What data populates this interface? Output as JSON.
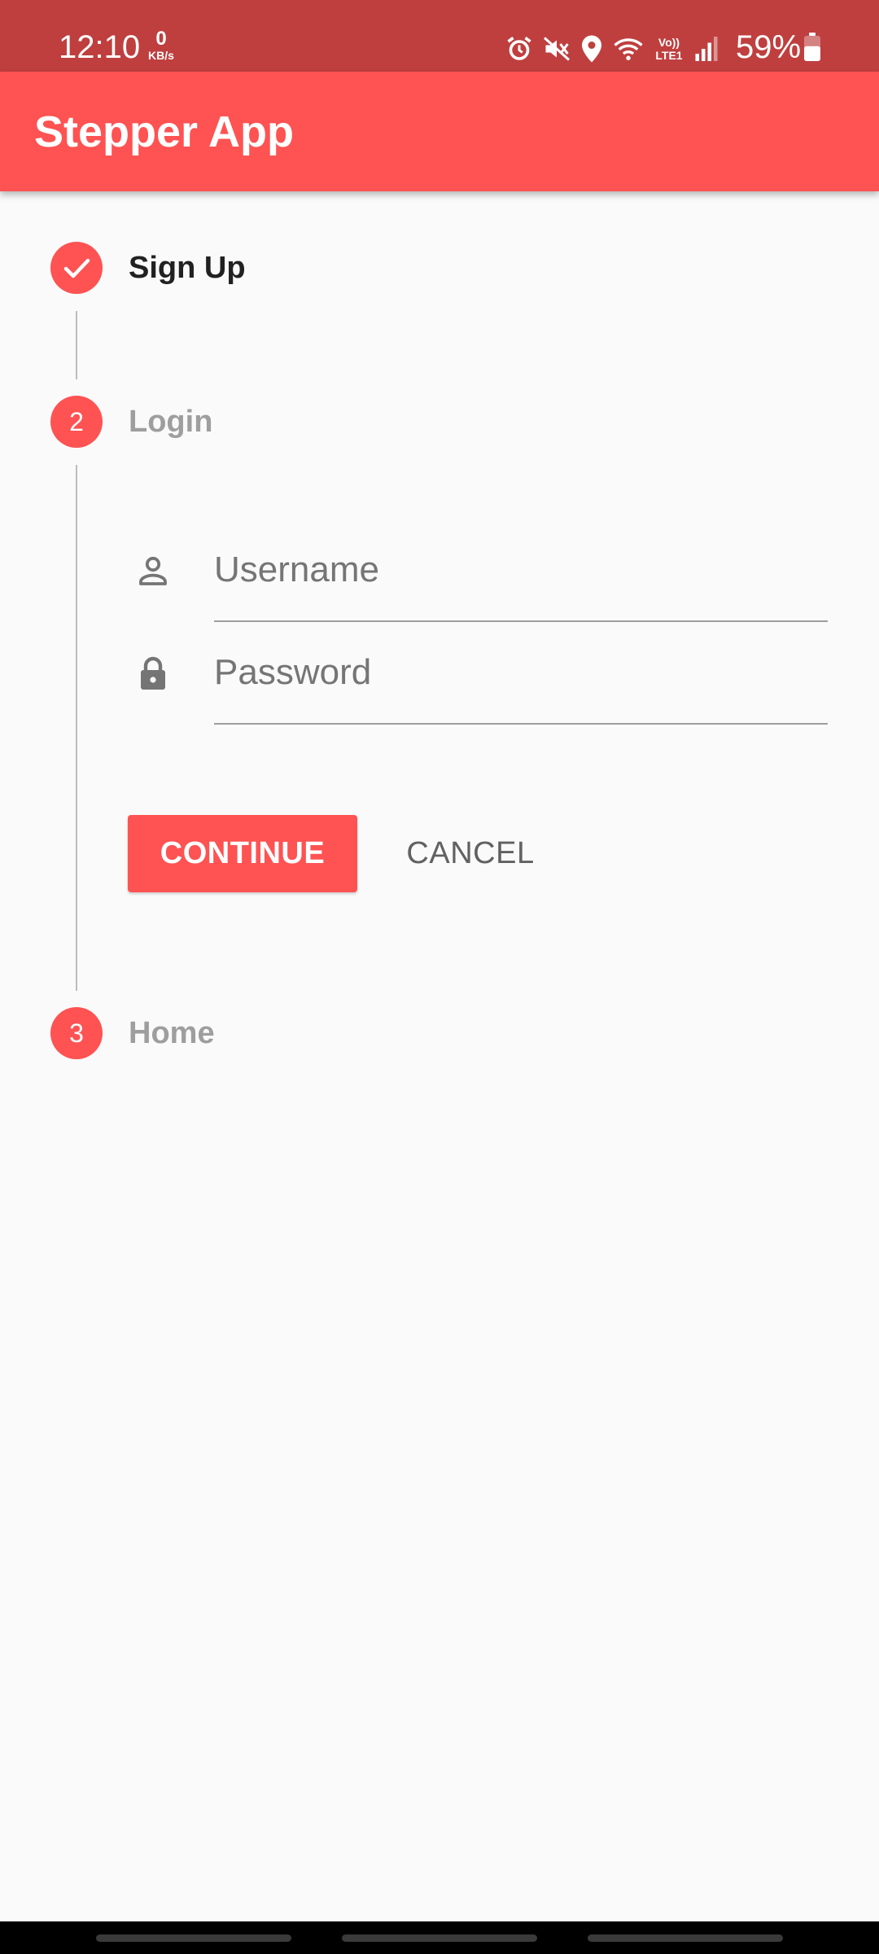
{
  "status_bar": {
    "time": "12:10",
    "net_speed_value": "0",
    "net_speed_unit": "KB/s",
    "volte_label": "Vo)) LTE1",
    "battery_percent": "59%",
    "battery_level": 0.59,
    "icons": [
      "alarm-icon",
      "vibrate-mute-icon",
      "location-icon",
      "wifi-icon",
      "volte-icon",
      "signal-icon",
      "battery-icon"
    ]
  },
  "app_bar": {
    "title": "Stepper App"
  },
  "stepper": {
    "steps": [
      {
        "number": "1",
        "title": "Sign Up",
        "state": "complete"
      },
      {
        "number": "2",
        "title": "Login",
        "state": "active"
      },
      {
        "number": "3",
        "title": "Home",
        "state": "inactive"
      }
    ]
  },
  "login_form": {
    "username_placeholder": "Username",
    "password_placeholder": "Password",
    "username_value": "",
    "password_value": ""
  },
  "controls": {
    "continue_label": "CONTINUE",
    "cancel_label": "CANCEL"
  },
  "theme": {
    "accent": "#ff5252",
    "status_bar": "#bf3f3f",
    "background": "#fafafa"
  }
}
